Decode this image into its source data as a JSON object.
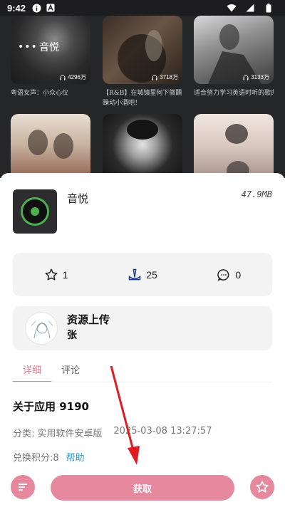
{
  "status_bar": {
    "time": "9:42"
  },
  "colors": {
    "accent": "#e7899e",
    "tab_active": "#e47a90",
    "link": "#2b9bd6",
    "disc_green": "#4caf50"
  },
  "background": {
    "cards": [
      {
        "title": "音悦",
        "plays": "4296万",
        "caption": "粤语女声：小众心仪"
      },
      {
        "plays": "3718万",
        "caption": "【R&B】在城镇里何下微醺·躁动小酒吧！"
      },
      {
        "plays": "3133万",
        "caption": "适合努力学习英语时听的歌曲"
      },
      {
        "caption": ""
      },
      {
        "caption": ""
      },
      {
        "caption": ""
      }
    ]
  },
  "app": {
    "name": "音悦",
    "size": "47.9MB",
    "icon": "music-disc-icon"
  },
  "stats": {
    "favorites": "1",
    "downloads": "25",
    "comments": "0"
  },
  "uploader": {
    "title": "资源上传",
    "name": "张"
  },
  "tabs": [
    {
      "label": "详细"
    },
    {
      "label": "评论"
    }
  ],
  "details": {
    "about": "关于应用 9190",
    "category_label": "分类:",
    "category": "实用软件安卓版",
    "date": "2025-03-08 13:27:57",
    "points": "兑换积分:8",
    "help": "帮助"
  },
  "actions": {
    "get": "获取"
  }
}
